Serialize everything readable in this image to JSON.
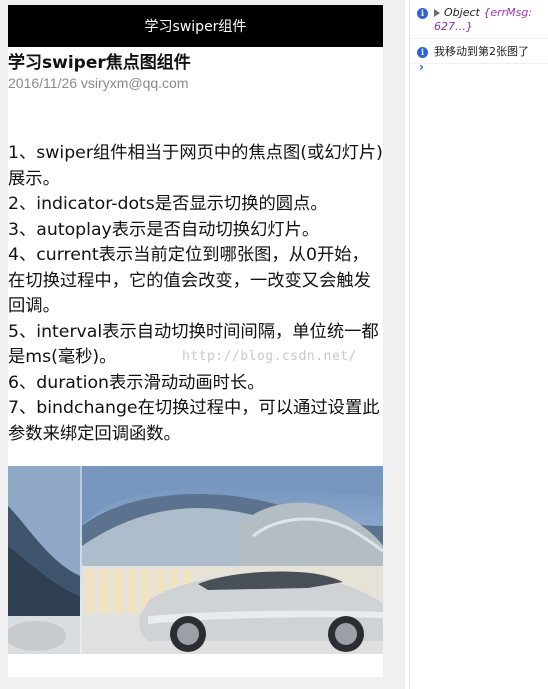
{
  "simulator": {
    "navbar_title": "学习swiper组件",
    "post": {
      "title": "学习swiper焦点图组件",
      "meta": "2016/11/26 vsiryxm@qq.com",
      "lines": [
        "1、swiper组件相当于网页中的焦点图(或幻灯片)展示。",
        "2、indicator-dots是否显示切换的圆点。",
        "3、autoplay表示是否自动切换幻灯片。",
        "4、current表示当前定位到哪张图，从0开始，在切换过程中，它的值会改变，一改变又会触发回调。",
        "5、interval表示自动切换时间间隔，单位统一都是ms(毫秒)。",
        "6、duration表示滑动动画时长。",
        "7、bindchange在切换过程中，可以通过设置此参数来绑定回调函数。"
      ],
      "watermark": "http://blog.csdn.net/"
    },
    "swiper": {
      "slides": 2,
      "current_index_shown": 1
    }
  },
  "console": {
    "entries": [
      {
        "type": "info",
        "object_label": "Object",
        "preview_open": "{",
        "preview_key": "errMsg:",
        "preview_value": "627…",
        "preview_close": "}"
      },
      {
        "type": "info",
        "message": "我移动到第2张图了"
      }
    ],
    "prompt": "›",
    "colors": {
      "info_icon": "#2d63d6",
      "object_preview": "#8a2fae"
    }
  }
}
